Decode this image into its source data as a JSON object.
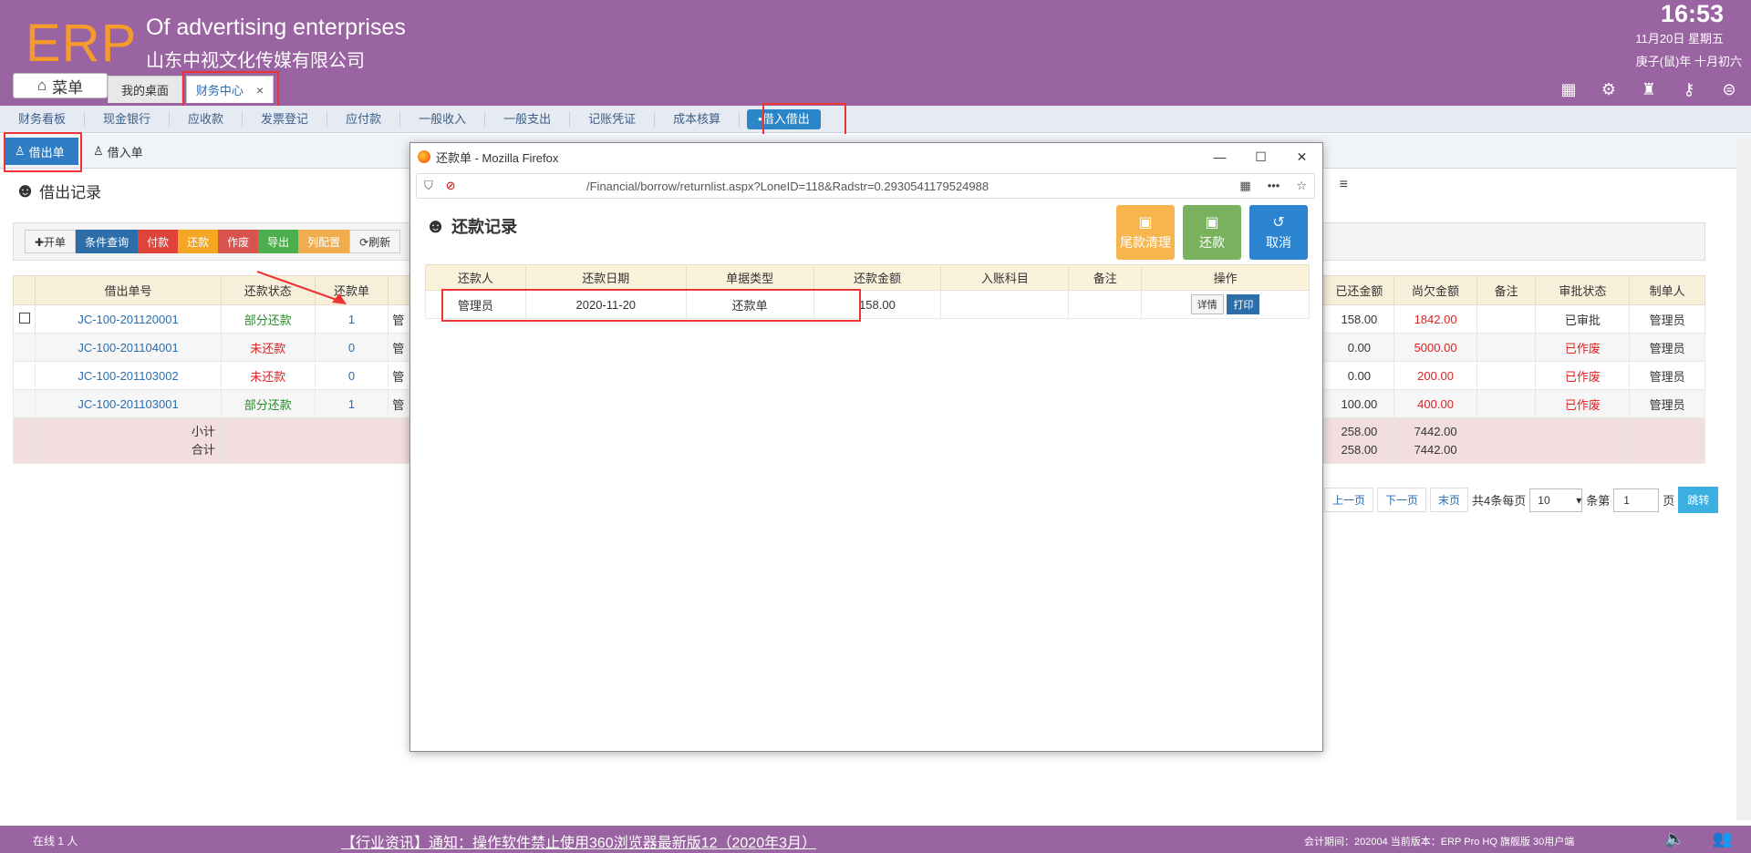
{
  "header": {
    "logo": "ERP",
    "brand_en": "Of advertising enterprises",
    "brand_cn": "山东中视文化传媒有限公司",
    "time": "16:53",
    "date": "11月20日 星期五",
    "lunar": "庚子(鼠)年 十月初六",
    "menu_label": "菜单",
    "tabs": [
      {
        "label": "我的桌面"
      },
      {
        "label": "财务中心",
        "close": "×"
      }
    ],
    "icons": [
      "grid-add-icon",
      "gear-icon",
      "clothes-icon",
      "key-icon",
      "collapse-icon"
    ]
  },
  "nav": {
    "items": [
      "财务看板",
      "现金银行",
      "应收款",
      "发票登记",
      "应付款",
      "一般收入",
      "一般支出",
      "记账凭证",
      "成本核算",
      "•借入借出"
    ],
    "active_index": 9
  },
  "subtabs": [
    "借出单",
    "借入单"
  ],
  "main": {
    "title": "借出记录",
    "toolbar": [
      "✚开单",
      "条件查询",
      "付款",
      "还款",
      "作废",
      "导出",
      "列配置",
      "⟳刷新"
    ],
    "columns": [
      "",
      "借出单号",
      "还款状态",
      "还款单",
      "",
      "已还金额",
      "尚欠金额",
      "备注",
      "审批状态",
      "制单人"
    ],
    "rows": [
      {
        "no": "JC-100-201120001",
        "status": "部分还款",
        "count": "1",
        "col4": "管",
        "paid": "158.00",
        "owed": "1842.00",
        "note": "",
        "approval": "已审批",
        "maker": "管理员"
      },
      {
        "no": "JC-100-201104001",
        "status": "未还款",
        "count": "0",
        "col4": "管",
        "paid": "0.00",
        "owed": "5000.00",
        "note": "",
        "approval": "已作废",
        "maker": "管理员"
      },
      {
        "no": "JC-100-201103002",
        "status": "未还款",
        "count": "0",
        "col4": "管",
        "paid": "0.00",
        "owed": "200.00",
        "note": "",
        "approval": "已作废",
        "maker": "管理员"
      },
      {
        "no": "JC-100-201103001",
        "status": "部分还款",
        "count": "1",
        "col4": "管",
        "paid": "100.00",
        "owed": "400.00",
        "note": "",
        "approval": "已作废",
        "maker": "管理员"
      }
    ],
    "subtotal_label": "小计",
    "total_label": "合计",
    "subtotal": {
      "paid": "258.00",
      "owed": "7442.00"
    },
    "total": {
      "paid": "258.00",
      "owed": "7442.00"
    },
    "pager": {
      "prev": "上一页",
      "next": "下一页",
      "last": "末页",
      "per_page_prefix": "共4条每页",
      "per_page": "10",
      "page_prefix": "条第",
      "page": "1",
      "page_suffix": "页",
      "go": "跳转"
    }
  },
  "popup": {
    "window_title": "还款单 - Mozilla Firefox",
    "url": "/Financial/borrow/returnlist.aspx?LoneID=118&Radstr=0.2930541179524988",
    "heading": "还款记录",
    "buttons": [
      "尾款清理",
      "还款",
      "取消"
    ],
    "columns": [
      "还款人",
      "还款日期",
      "单据类型",
      "还款金额",
      "入账科目",
      "备注",
      "操作"
    ],
    "rows": [
      {
        "person": "管理员",
        "date": "2020-11-20",
        "type": "还款单",
        "amount": "158.00",
        "account": "",
        "note": "",
        "detail": "详情",
        "print": "打印"
      }
    ]
  },
  "footer": {
    "online": "在线  1  人",
    "news": "【行业资讯】通知：操作软件禁止使用360浏览器最新版12（2020年3月）",
    "version": "会计期间：202004 当前版本：ERP Pro HQ 旗舰版 30用户端"
  },
  "colors": {
    "header_bg": "#9a63a1",
    "logo": "#f59a2d",
    "highlight_box": "#e33333"
  }
}
